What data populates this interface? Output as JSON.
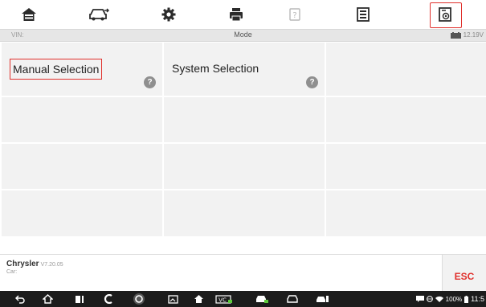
{
  "toolbar": {
    "items": [
      {
        "name": "home-icon"
      },
      {
        "name": "vehicle-swap-icon"
      },
      {
        "name": "settings-icon"
      },
      {
        "name": "print-icon"
      },
      {
        "name": "help-icon"
      },
      {
        "name": "save-icon"
      },
      {
        "name": "data-logging-icon"
      }
    ]
  },
  "strip": {
    "vin_label": "VIN:",
    "title": "Mode",
    "voltage": "12.19V"
  },
  "grid": {
    "cells": [
      {
        "label": "Manual Selection",
        "help": "?"
      },
      {
        "label": "System Selection",
        "help": "?"
      }
    ]
  },
  "footer": {
    "make": "Chrysler",
    "version": "V7.20.05",
    "car_label": "Car:",
    "esc_label": "ESC"
  },
  "navbar": {
    "battery": "100%",
    "time": "11:5"
  },
  "colors": {
    "accent_red": "#e0302c",
    "cell_bg": "#f2f2f2",
    "navbar_bg": "#1c1c1c"
  }
}
